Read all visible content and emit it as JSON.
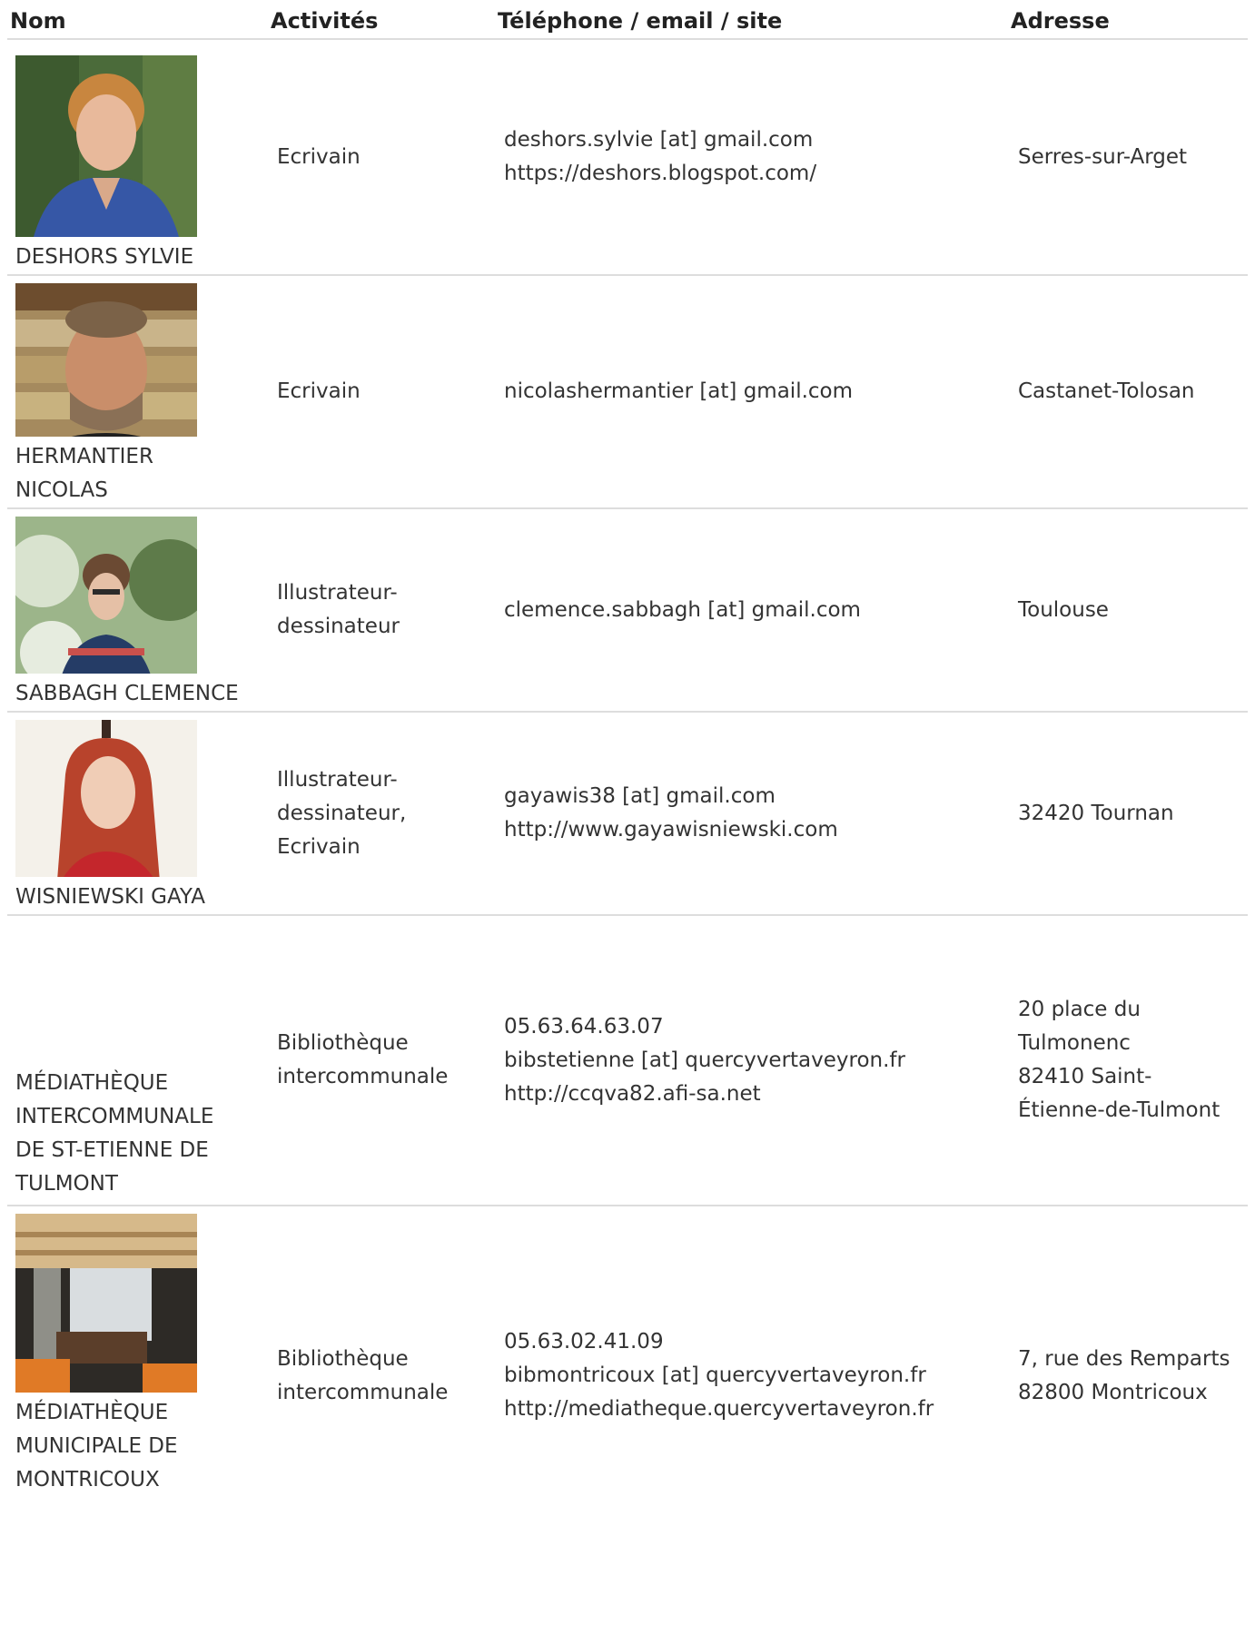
{
  "header": {
    "nom": "Nom",
    "activites": "Activités",
    "contact": "Téléphone / email / site",
    "adresse": "Adresse"
  },
  "rows": [
    {
      "name_lines": [
        "DESHORS SYLVIE"
      ],
      "activity_lines": [
        "Ecrivain"
      ],
      "contact_lines": [
        "deshors.sylvie [at] gmail.com",
        "https://deshors.blogspot.com/"
      ],
      "address_lines": [
        "Serres-sur-Arget"
      ],
      "photo": "portrait-deshors"
    },
    {
      "name_lines": [
        "HERMANTIER",
        "NICOLAS"
      ],
      "activity_lines": [
        "Ecrivain"
      ],
      "contact_lines": [
        "nicolashermantier [at] gmail.com"
      ],
      "address_lines": [
        "Castanet-Tolosan"
      ],
      "photo": "portrait-hermantier"
    },
    {
      "name_lines": [
        "SABBAGH CLEMENCE"
      ],
      "activity_lines": [
        "Illustrateur-",
        "dessinateur"
      ],
      "contact_lines": [
        "clemence.sabbagh [at] gmail.com"
      ],
      "address_lines": [
        "Toulouse"
      ],
      "photo": "portrait-sabbagh"
    },
    {
      "name_lines": [
        "WISNIEWSKI GAYA"
      ],
      "activity_lines": [
        "Illustrateur-",
        "dessinateur,",
        "Ecrivain"
      ],
      "contact_lines": [
        "gayawis38 [at] gmail.com",
        "http://www.gayawisniewski.com"
      ],
      "address_lines": [
        "32420 Tournan"
      ],
      "photo": "portrait-wisniewski"
    },
    {
      "name_lines": [
        "MÉDIATHÈQUE",
        "INTERCOMMUNALE",
        "DE ST-ETIENNE DE",
        "TULMONT"
      ],
      "activity_lines": [
        "Bibliothèque",
        "intercommunale"
      ],
      "contact_lines": [
        "05.63.64.63.07",
        "bibstetienne [at] quercyvertaveyron.fr",
        "http://ccqva82.afi-sa.net"
      ],
      "address_lines": [
        "20 place du",
        "Tulmonenc",
        "82410 Saint-",
        "Étienne-de-Tulmont"
      ],
      "photo": null
    },
    {
      "name_lines": [
        "MÉDIATHÈQUE",
        "MUNICIPALE DE",
        "MONTRICOUX"
      ],
      "activity_lines": [
        "Bibliothèque",
        "intercommunale"
      ],
      "contact_lines": [
        "05.63.02.41.09",
        "bibmontricoux [at] quercyvertaveyron.fr",
        "http://mediatheque.quercyvertaveyron.fr"
      ],
      "address_lines": [
        "7, rue des Remparts",
        "82800 Montricoux"
      ],
      "photo": "library-interior"
    }
  ]
}
